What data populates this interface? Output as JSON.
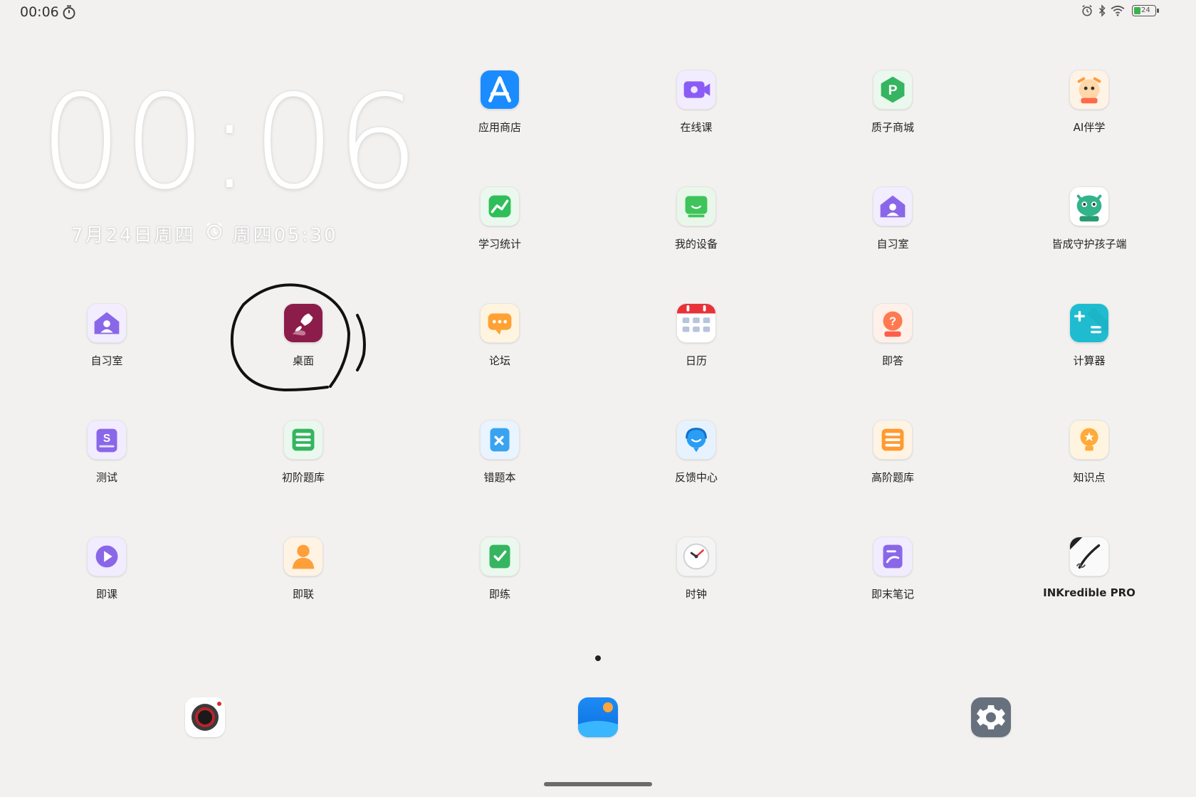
{
  "status_bar": {
    "time": "00:06",
    "battery_level": "24",
    "icons": [
      "timer-icon",
      "alarm-icon",
      "bluetooth-icon",
      "wifi-icon",
      "battery-icon"
    ]
  },
  "clock_widget": {
    "time": "00:06",
    "date": "7月24日周四",
    "alarm": "周四05:30"
  },
  "apps": [
    {
      "label": "应用商店",
      "icon": "app-store-icon",
      "color": "#1a8cff"
    },
    {
      "label": "在线课",
      "icon": "online-class-icon",
      "color": "#8a5cf5"
    },
    {
      "label": "质子商城",
      "icon": "proton-mall-icon",
      "color": "#35b560"
    },
    {
      "label": "AI伴学",
      "icon": "ai-companion-icon",
      "color": "#ff8a3d"
    },
    {
      "label": "学习统计",
      "icon": "study-stats-icon",
      "color": "#2fbf5a"
    },
    {
      "label": "我的设备",
      "icon": "my-device-icon",
      "color": "#3ec45a"
    },
    {
      "label": "自习室",
      "icon": "study-room-icon",
      "color": "#8a67e8"
    },
    {
      "label": "皆成守护孩子端",
      "icon": "guardian-child-icon",
      "color": "#33b38a"
    },
    {
      "label": "自习室",
      "icon": "study-room-icon",
      "color": "#8a67e8"
    },
    {
      "label": "桌面",
      "icon": "desktop-launcher-icon",
      "color": "#8c1c4a"
    },
    {
      "label": "论坛",
      "icon": "forum-icon",
      "color": "#ffa133"
    },
    {
      "label": "日历",
      "icon": "calendar-icon",
      "color": "#e8323a"
    },
    {
      "label": "即答",
      "icon": "instant-answer-icon",
      "color": "#ff7a50"
    },
    {
      "label": "计算器",
      "icon": "calculator-icon",
      "color": "#1fbcd0"
    },
    {
      "label": "测试",
      "icon": "test-icon",
      "color": "#8a67e8"
    },
    {
      "label": "初阶题库",
      "icon": "basic-question-bank-icon",
      "color": "#35b560"
    },
    {
      "label": "错题本",
      "icon": "mistake-book-icon",
      "color": "#3aa3f0"
    },
    {
      "label": "反馈中心",
      "icon": "feedback-center-icon",
      "color": "#2a9df4"
    },
    {
      "label": "高阶题库",
      "icon": "advanced-question-bank-icon",
      "color": "#ff9a30"
    },
    {
      "label": "知识点",
      "icon": "knowledge-point-icon",
      "color": "#ffab3a"
    },
    {
      "label": "即课",
      "icon": "instant-lesson-icon",
      "color": "#8a67e8"
    },
    {
      "label": "即联",
      "icon": "instant-contact-icon",
      "color": "#ff9f3a"
    },
    {
      "label": "即练",
      "icon": "instant-practice-icon",
      "color": "#35b560"
    },
    {
      "label": "时钟",
      "icon": "clock-icon",
      "color": "#e8323a"
    },
    {
      "label": "即末笔记",
      "icon": "notes-icon",
      "color": "#8a67e8"
    },
    {
      "label": "INKredible PRO",
      "icon": "inkredible-pro-icon",
      "color": "#222222"
    }
  ],
  "page_indicator": {
    "current": 1,
    "total": 1
  },
  "dock": [
    {
      "name": "camera-icon"
    },
    {
      "name": "gallery-icon"
    },
    {
      "name": "settings-icon"
    }
  ],
  "annotation": {
    "type": "hand-drawn circle",
    "target": "桌面"
  }
}
